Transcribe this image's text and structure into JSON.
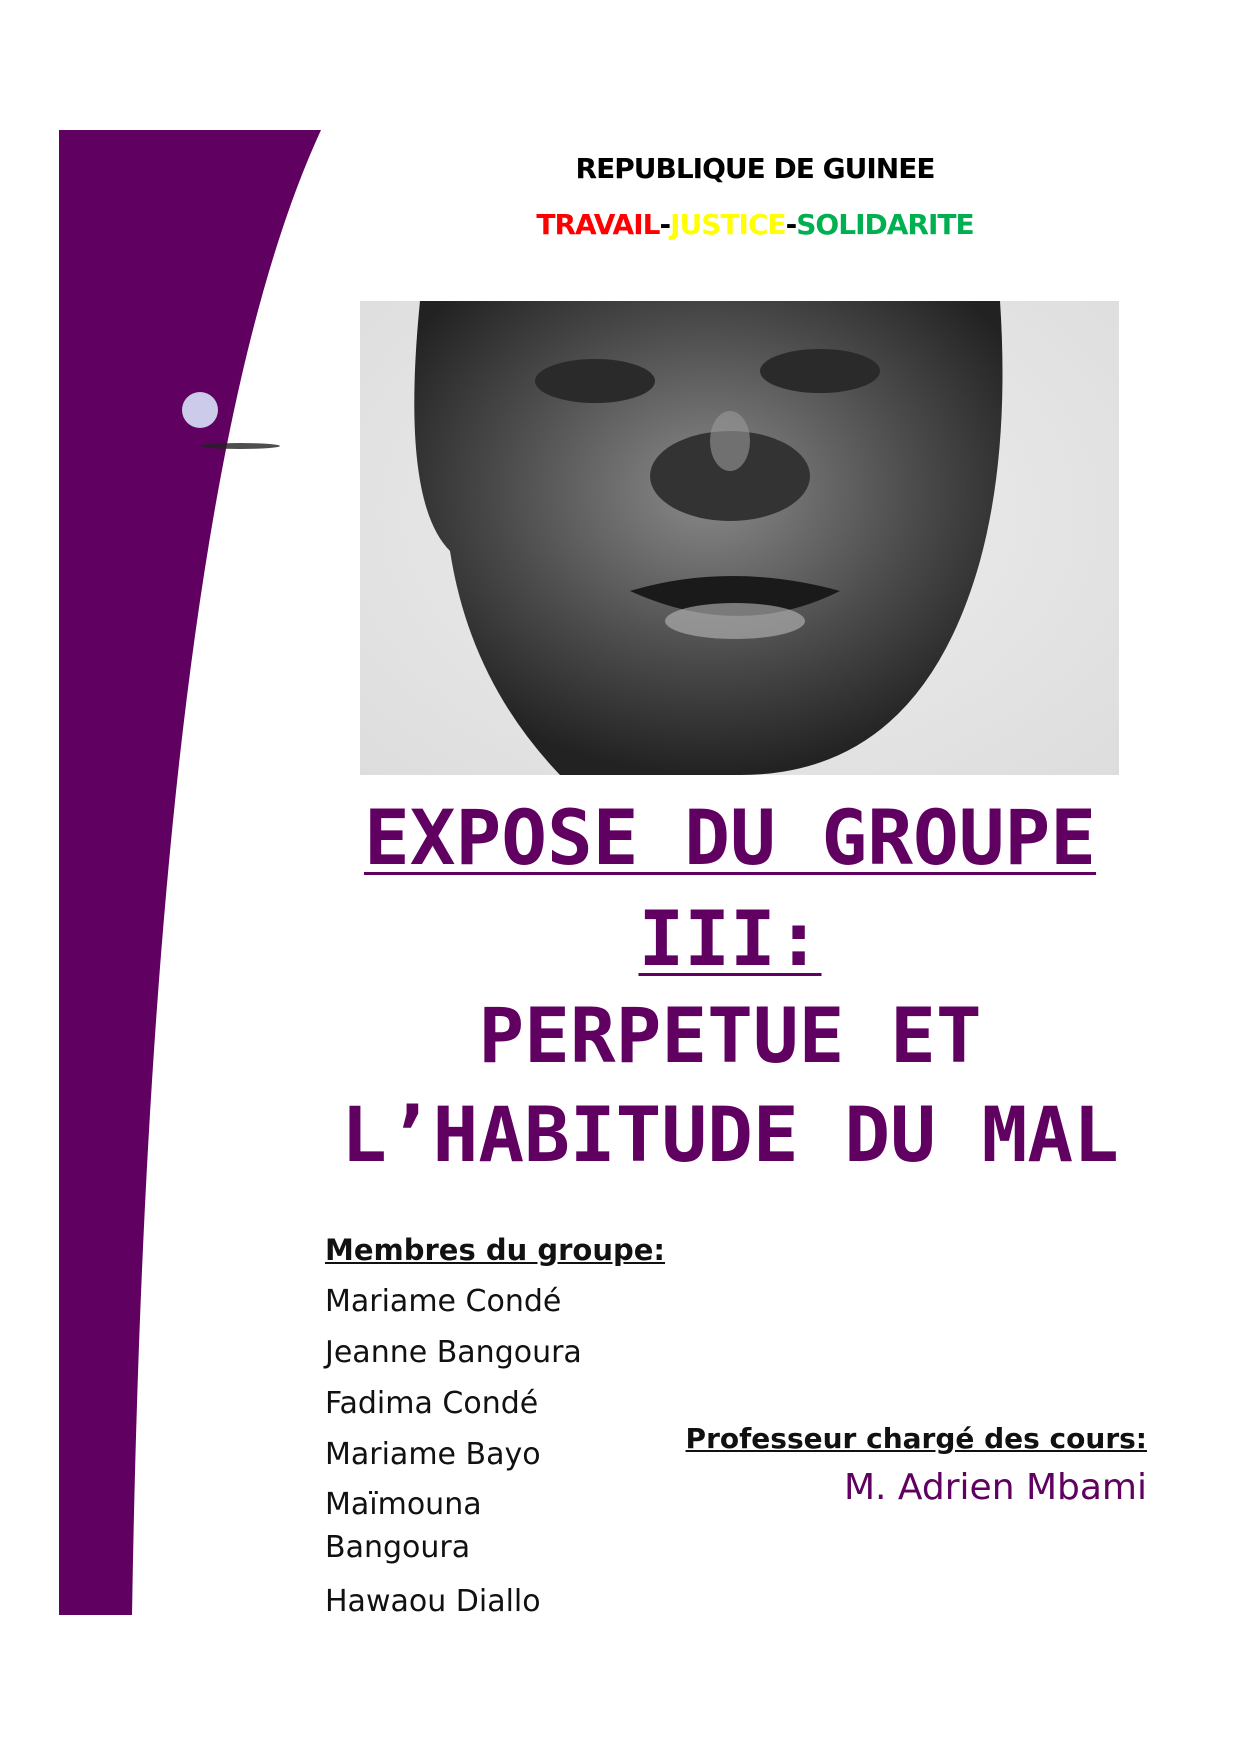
{
  "header": {
    "country": "REPUBLIQUE DE GUINEE",
    "motto": {
      "part1": "TRAVAIL",
      "sep1": "-",
      "part2": "JUSTICE",
      "sep2": "-",
      "part3": "SOLIDARITE"
    }
  },
  "colors": {
    "accent": "#600060",
    "red": "#ff0000",
    "yellow": "#ffff00",
    "green": "#00b050",
    "circle": "#ccccea"
  },
  "title": {
    "line1": "EXPOSE DU GROUPE",
    "line2": "III:",
    "line3": "PERPETUE ET",
    "line4": "L’HABITUDE DU MAL"
  },
  "members": {
    "heading": "Membres du groupe:",
    "names": [
      "Mariame Condé",
      "Jeanne Bangoura",
      "Fadima Condé",
      "Mariame Bayo",
      "Maïmouna",
      "Bangoura",
      "Hawaou Diallo"
    ]
  },
  "professor": {
    "heading": "Professeur chargé des cours:",
    "name": "M. Adrien Mbami"
  }
}
